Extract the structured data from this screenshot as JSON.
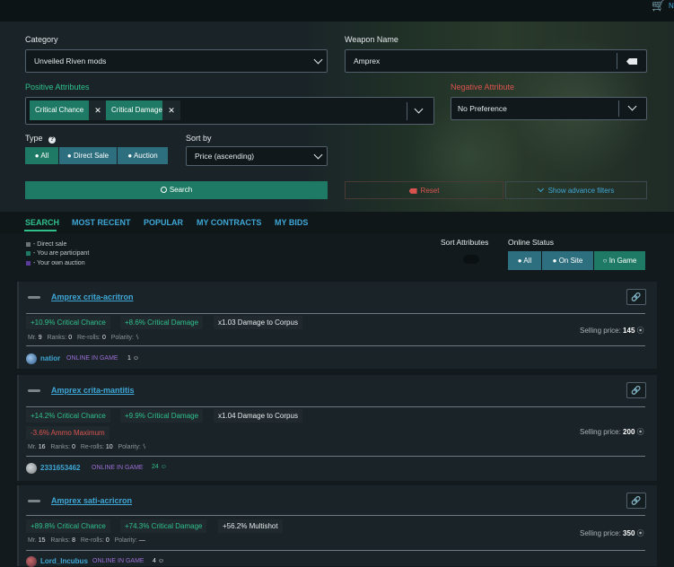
{
  "topbar": {
    "cart_count": "N"
  },
  "filters": {
    "category_label": "Category",
    "category_value": "Unveiled Riven mods",
    "weapon_label": "Weapon Name",
    "weapon_value": "Amprex",
    "positive_label": "Positive Attributes",
    "positive_chips": [
      "Critical Chance",
      "Critical Damage"
    ],
    "negative_label": "Negative Attribute",
    "negative_value": "No Preference",
    "type_label": "Type",
    "type_options": [
      "All",
      "Direct Sale",
      "Auction"
    ],
    "sort_label": "Sort by",
    "sort_value": "Price (ascending)",
    "search_button": "Search",
    "reset_button": "Reset",
    "advanced_button": "Show advance filters"
  },
  "tabs": [
    "SEARCH",
    "MOST RECENT",
    "POPULAR",
    "MY CONTRACTS",
    "MY BIDS"
  ],
  "legend": [
    "- Direct sale",
    "- You are participant",
    "- Your own auction"
  ],
  "legend_colors": [
    "#6b7378",
    "#1e7a64",
    "#5a3a9a"
  ],
  "sort_attributes_label": "Sort Attributes",
  "online_status": {
    "label": "Online Status",
    "options": [
      "All",
      "On Site",
      "In Game"
    ]
  },
  "colors": {
    "accent_green": "#2fc08c",
    "accent_blue": "#3fa7d6",
    "negative_red": "#d9534f",
    "status_purple": "#9b6fd6"
  },
  "listings": [
    {
      "title": "Amprex crita-acritron",
      "attributes": [
        {
          "text": "+10.9% Critical Chance",
          "kind": "pos"
        },
        {
          "text": "+8.6% Critical Damage",
          "kind": "pos"
        },
        {
          "text": "x1.03 Damage to Corpus",
          "kind": "neu"
        }
      ],
      "mr_label": "Mr.",
      "mr": "9",
      "ranks_label": "Ranks:",
      "ranks": "0",
      "rerolls_label": "Re-rolls:",
      "rerolls": "0",
      "polarity_label": "Polarity:",
      "polarity": "ᛊ",
      "price_label": "Selling price:",
      "price": "145",
      "user": "natior",
      "status": "ONLINE IN GAME",
      "rep": "1"
    },
    {
      "title": "Amprex crita-mantitis",
      "attributes": [
        {
          "text": "+14.2% Critical Chance",
          "kind": "pos"
        },
        {
          "text": "+9.9% Critical Damage",
          "kind": "pos"
        },
        {
          "text": "x1.04 Damage to Corpus",
          "kind": "neu"
        },
        {
          "text": "-3.6% Ammo Maximum",
          "kind": "neg"
        }
      ],
      "mr_label": "Mr.",
      "mr": "16",
      "ranks_label": "Ranks:",
      "ranks": "0",
      "rerolls_label": "Re-rolls:",
      "rerolls": "10",
      "polarity_label": "Polarity:",
      "polarity": "ᛊ",
      "price_label": "Selling price:",
      "price": "200",
      "user": "2331653462",
      "status": "ONLINE IN GAME",
      "rep": "24"
    },
    {
      "title": "Amprex sati-acricron",
      "attributes": [
        {
          "text": "+89.8% Critical Chance",
          "kind": "pos"
        },
        {
          "text": "+74.3% Critical Damage",
          "kind": "pos"
        },
        {
          "text": "+56.2% Multishot",
          "kind": "neu"
        }
      ],
      "mr_label": "Mr.",
      "mr": "15",
      "ranks_label": "Ranks:",
      "ranks": "8",
      "rerolls_label": "Re-rolls:",
      "rerolls": "0",
      "polarity_label": "Polarity:",
      "polarity": "—",
      "price_label": "Selling price:",
      "price": "350",
      "user": "Lord_Incubus",
      "status": "ONLINE IN GAME",
      "rep": "4"
    }
  ]
}
